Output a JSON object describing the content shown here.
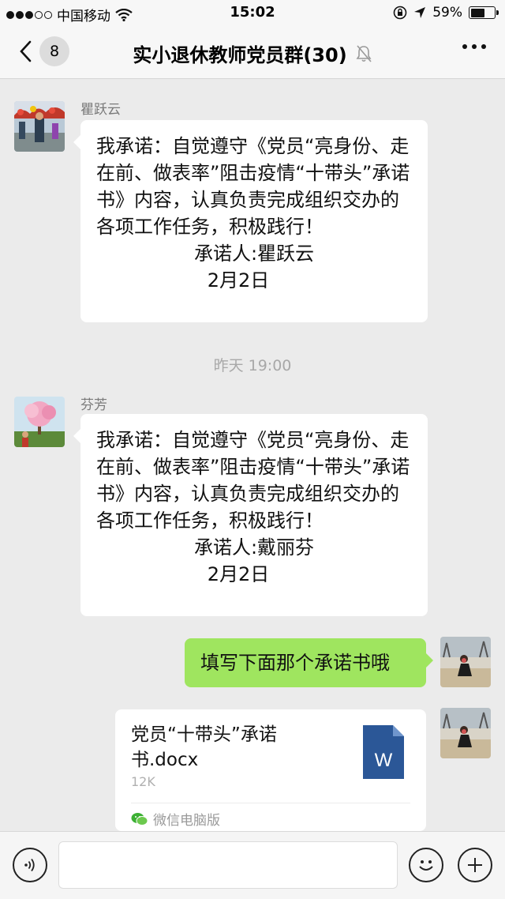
{
  "status_bar": {
    "carrier": "中国移动",
    "time": "15:02",
    "battery": "59%",
    "battery_level": 0.59
  },
  "nav": {
    "back_count": "8",
    "title": "实小退休教师党员群(30)"
  },
  "messages": [
    {
      "sender": "瞿跃云",
      "text": "我承诺：自觉遵守《党员“亮身份、走在前、做表率”阻击疫情“十带头”承诺书》内容，认真负责完成组织交办的各项工作任务，积极践行！",
      "signer": "承诺人:瞿跃云",
      "date": "2月2日"
    },
    {
      "sender": "芬芳",
      "text": "我承诺：自觉遵守《党员“亮身份、走在前、做表率”阻击疫情“十带头”承诺书》内容，认真负责完成组织交办的各项工作任务，积极践行！",
      "signer": "承诺人:戴丽芬",
      "date": "2月2日"
    }
  ],
  "timestamp": "昨天 19:00",
  "my_message": "填写下面那个承诺书哦",
  "file": {
    "name": "党员“十带头”承诺书.docx",
    "size": "12K",
    "icon_letter": "W",
    "source": "微信电脑版"
  },
  "colors": {
    "bubble_green": "#9fe55f",
    "word_blue": "#2b5797",
    "wechat_green": "#3cb034"
  }
}
